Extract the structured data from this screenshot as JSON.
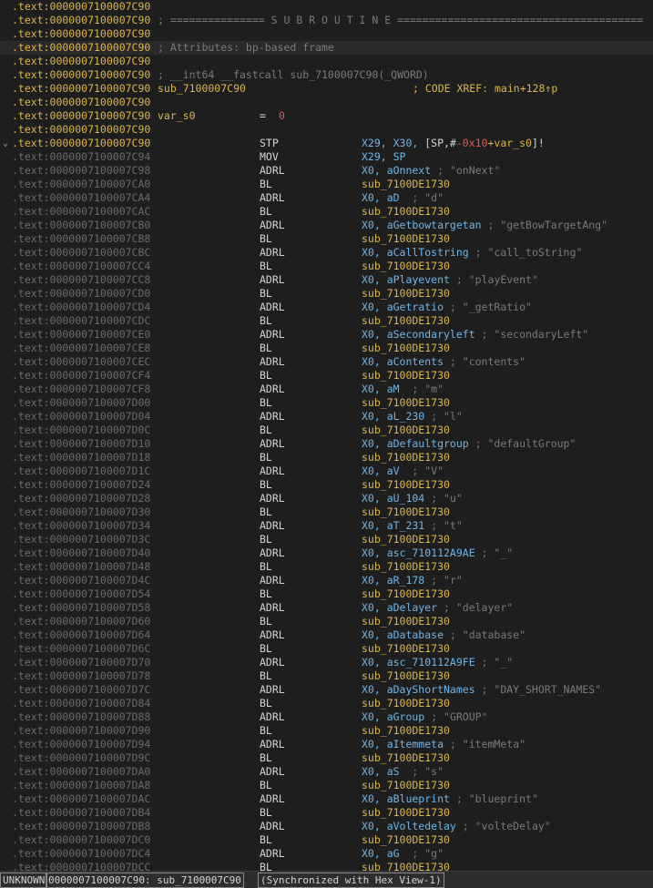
{
  "listing": {
    "header": [
      {
        "addr": ".text:0000007100007C90",
        "text": ""
      },
      {
        "addr": ".text:0000007100007C90",
        "text": "; =============== S U B R O U T I N E ======================================="
      },
      {
        "addr": ".text:0000007100007C90",
        "text": ""
      },
      {
        "addr": ".text:0000007100007C90",
        "text": "; Attributes: bp-based frame"
      },
      {
        "addr": ".text:0000007100007C90",
        "text": ""
      },
      {
        "addr": ".text:0000007100007C90",
        "text": "; __int64 __fastcall sub_7100007C90(_QWORD)"
      }
    ],
    "proc_line": {
      "addr": ".text:0000007100007C90",
      "name": "sub_7100007C90",
      "xref": "; CODE XREF: main+128↑p"
    },
    "blank_after_proc": {
      "addr": ".text:0000007100007C90"
    },
    "var_line": {
      "addr": ".text:0000007100007C90",
      "name": "var_s0",
      "eq": "=",
      "value": "0"
    },
    "blank_after_var": {
      "addr": ".text:0000007100007C90"
    },
    "stp_line": {
      "addr": ".text:0000007100007C90",
      "mnemonic": "STP",
      "reg1": "X29, X30, ",
      "mem_open": "[SP,#",
      "neg": "-0x10",
      "plus": "+var_s0",
      "mem_close": "]!"
    },
    "instructions": [
      {
        "addr": ".text:0000007100007C94",
        "mn": "MOV",
        "reg": "X29, SP",
        "tgt": "",
        "cmt": ""
      },
      {
        "addr": ".text:0000007100007C98",
        "mn": "ADRL",
        "reg": "X0, aOnnext",
        "tgt": "",
        "cmt": " ; \"onNext\""
      },
      {
        "addr": ".text:0000007100007CA0",
        "mn": "BL",
        "reg": "",
        "tgt": "sub_7100DE1730",
        "cmt": ""
      },
      {
        "addr": ".text:0000007100007CA4",
        "mn": "ADRL",
        "reg": "X0, aD",
        "tgt": "",
        "cmt": "  ; \"d\""
      },
      {
        "addr": ".text:0000007100007CAC",
        "mn": "BL",
        "reg": "",
        "tgt": "sub_7100DE1730",
        "cmt": ""
      },
      {
        "addr": ".text:0000007100007CB0",
        "mn": "ADRL",
        "reg": "X0, aGetbowtargetan",
        "tgt": "",
        "cmt": " ; \"getBowTargetAng\""
      },
      {
        "addr": ".text:0000007100007CB8",
        "mn": "BL",
        "reg": "",
        "tgt": "sub_7100DE1730",
        "cmt": ""
      },
      {
        "addr": ".text:0000007100007CBC",
        "mn": "ADRL",
        "reg": "X0, aCallTostring",
        "tgt": "",
        "cmt": " ; \"call_toString\""
      },
      {
        "addr": ".text:0000007100007CC4",
        "mn": "BL",
        "reg": "",
        "tgt": "sub_7100DE1730",
        "cmt": ""
      },
      {
        "addr": ".text:0000007100007CC8",
        "mn": "ADRL",
        "reg": "X0, aPlayevent",
        "tgt": "",
        "cmt": " ; \"playEvent\""
      },
      {
        "addr": ".text:0000007100007CD0",
        "mn": "BL",
        "reg": "",
        "tgt": "sub_7100DE1730",
        "cmt": ""
      },
      {
        "addr": ".text:0000007100007CD4",
        "mn": "ADRL",
        "reg": "X0, aGetratio",
        "tgt": "",
        "cmt": " ; \"_getRatio\""
      },
      {
        "addr": ".text:0000007100007CDC",
        "mn": "BL",
        "reg": "",
        "tgt": "sub_7100DE1730",
        "cmt": ""
      },
      {
        "addr": ".text:0000007100007CE0",
        "mn": "ADRL",
        "reg": "X0, aSecondaryleft",
        "tgt": "",
        "cmt": " ; \"secondaryLeft\""
      },
      {
        "addr": ".text:0000007100007CE8",
        "mn": "BL",
        "reg": "",
        "tgt": "sub_7100DE1730",
        "cmt": ""
      },
      {
        "addr": ".text:0000007100007CEC",
        "mn": "ADRL",
        "reg": "X0, aContents",
        "tgt": "",
        "cmt": " ; \"contents\""
      },
      {
        "addr": ".text:0000007100007CF4",
        "mn": "BL",
        "reg": "",
        "tgt": "sub_7100DE1730",
        "cmt": ""
      },
      {
        "addr": ".text:0000007100007CF8",
        "mn": "ADRL",
        "reg": "X0, aM",
        "tgt": "",
        "cmt": "  ; \"m\""
      },
      {
        "addr": ".text:0000007100007D00",
        "mn": "BL",
        "reg": "",
        "tgt": "sub_7100DE1730",
        "cmt": ""
      },
      {
        "addr": ".text:0000007100007D04",
        "mn": "ADRL",
        "reg": "X0, aL_230",
        "tgt": "",
        "cmt": " ; \"l\""
      },
      {
        "addr": ".text:0000007100007D0C",
        "mn": "BL",
        "reg": "",
        "tgt": "sub_7100DE1730",
        "cmt": ""
      },
      {
        "addr": ".text:0000007100007D10",
        "mn": "ADRL",
        "reg": "X0, aDefaultgroup",
        "tgt": "",
        "cmt": " ; \"defaultGroup\""
      },
      {
        "addr": ".text:0000007100007D18",
        "mn": "BL",
        "reg": "",
        "tgt": "sub_7100DE1730",
        "cmt": ""
      },
      {
        "addr": ".text:0000007100007D1C",
        "mn": "ADRL",
        "reg": "X0, aV",
        "tgt": "",
        "cmt": "  ; \"V\""
      },
      {
        "addr": ".text:0000007100007D24",
        "mn": "BL",
        "reg": "",
        "tgt": "sub_7100DE1730",
        "cmt": ""
      },
      {
        "addr": ".text:0000007100007D28",
        "mn": "ADRL",
        "reg": "X0, aU_104",
        "tgt": "",
        "cmt": " ; \"u\""
      },
      {
        "addr": ".text:0000007100007D30",
        "mn": "BL",
        "reg": "",
        "tgt": "sub_7100DE1730",
        "cmt": ""
      },
      {
        "addr": ".text:0000007100007D34",
        "mn": "ADRL",
        "reg": "X0, aT_231",
        "tgt": "",
        "cmt": " ; \"t\""
      },
      {
        "addr": ".text:0000007100007D3C",
        "mn": "BL",
        "reg": "",
        "tgt": "sub_7100DE1730",
        "cmt": ""
      },
      {
        "addr": ".text:0000007100007D40",
        "mn": "ADRL",
        "reg": "X0, asc_710112A9AE",
        "tgt": "",
        "cmt": " ; \"_\""
      },
      {
        "addr": ".text:0000007100007D48",
        "mn": "BL",
        "reg": "",
        "tgt": "sub_7100DE1730",
        "cmt": ""
      },
      {
        "addr": ".text:0000007100007D4C",
        "mn": "ADRL",
        "reg": "X0, aR_178",
        "tgt": "",
        "cmt": " ; \"r\""
      },
      {
        "addr": ".text:0000007100007D54",
        "mn": "BL",
        "reg": "",
        "tgt": "sub_7100DE1730",
        "cmt": ""
      },
      {
        "addr": ".text:0000007100007D58",
        "mn": "ADRL",
        "reg": "X0, aDelayer",
        "tgt": "",
        "cmt": " ; \"delayer\""
      },
      {
        "addr": ".text:0000007100007D60",
        "mn": "BL",
        "reg": "",
        "tgt": "sub_7100DE1730",
        "cmt": ""
      },
      {
        "addr": ".text:0000007100007D64",
        "mn": "ADRL",
        "reg": "X0, aDatabase",
        "tgt": "",
        "cmt": " ; \"database\""
      },
      {
        "addr": ".text:0000007100007D6C",
        "mn": "BL",
        "reg": "",
        "tgt": "sub_7100DE1730",
        "cmt": ""
      },
      {
        "addr": ".text:0000007100007D70",
        "mn": "ADRL",
        "reg": "X0, asc_710112A9FE",
        "tgt": "",
        "cmt": " ; \"_\""
      },
      {
        "addr": ".text:0000007100007D78",
        "mn": "BL",
        "reg": "",
        "tgt": "sub_7100DE1730",
        "cmt": ""
      },
      {
        "addr": ".text:0000007100007D7C",
        "mn": "ADRL",
        "reg": "X0, aDayShortNames",
        "tgt": "",
        "cmt": " ; \"DAY_SHORT_NAMES\""
      },
      {
        "addr": ".text:0000007100007D84",
        "mn": "BL",
        "reg": "",
        "tgt": "sub_7100DE1730",
        "cmt": ""
      },
      {
        "addr": ".text:0000007100007D88",
        "mn": "ADRL",
        "reg": "X0, aGroup",
        "tgt": "",
        "cmt": " ; \"GROUP\""
      },
      {
        "addr": ".text:0000007100007D90",
        "mn": "BL",
        "reg": "",
        "tgt": "sub_7100DE1730",
        "cmt": ""
      },
      {
        "addr": ".text:0000007100007D94",
        "mn": "ADRL",
        "reg": "X0, aItemmeta",
        "tgt": "",
        "cmt": " ; \"itemMeta\""
      },
      {
        "addr": ".text:0000007100007D9C",
        "mn": "BL",
        "reg": "",
        "tgt": "sub_7100DE1730",
        "cmt": ""
      },
      {
        "addr": ".text:0000007100007DA0",
        "mn": "ADRL",
        "reg": "X0, aS",
        "tgt": "",
        "cmt": "  ; \"s\""
      },
      {
        "addr": ".text:0000007100007DA8",
        "mn": "BL",
        "reg": "",
        "tgt": "sub_7100DE1730",
        "cmt": ""
      },
      {
        "addr": ".text:0000007100007DAC",
        "mn": "ADRL",
        "reg": "X0, aBlueprint",
        "tgt": "",
        "cmt": " ; \"blueprint\""
      },
      {
        "addr": ".text:0000007100007DB4",
        "mn": "BL",
        "reg": "",
        "tgt": "sub_7100DE1730",
        "cmt": ""
      },
      {
        "addr": ".text:0000007100007DB8",
        "mn": "ADRL",
        "reg": "X0, aVoltedelay",
        "tgt": "",
        "cmt": " ; \"volteDelay\""
      },
      {
        "addr": ".text:0000007100007DC0",
        "mn": "BL",
        "reg": "",
        "tgt": "sub_7100DE1730",
        "cmt": ""
      },
      {
        "addr": ".text:0000007100007DC4",
        "mn": "ADRL",
        "reg": "X0, aG",
        "tgt": "",
        "cmt": "  ; \"g\""
      },
      {
        "addr": ".text:0000007100007DCC",
        "mn": "BL",
        "reg": "",
        "tgt": "sub_7100DE1730",
        "cmt": ""
      }
    ]
  },
  "statusbar": {
    "mode": "UNKNOWN",
    "location": "0000007100007C90: sub_7100007C90",
    "sync": "(Synchronized with Hex View-1)"
  },
  "colors": {
    "background": "#1e1e1e",
    "address_active": "#dcb54b",
    "address_dim": "#6b6b6b",
    "register": "#6fb6e8",
    "comment": "#7a7a7a",
    "immediate": "#e05a5a"
  }
}
